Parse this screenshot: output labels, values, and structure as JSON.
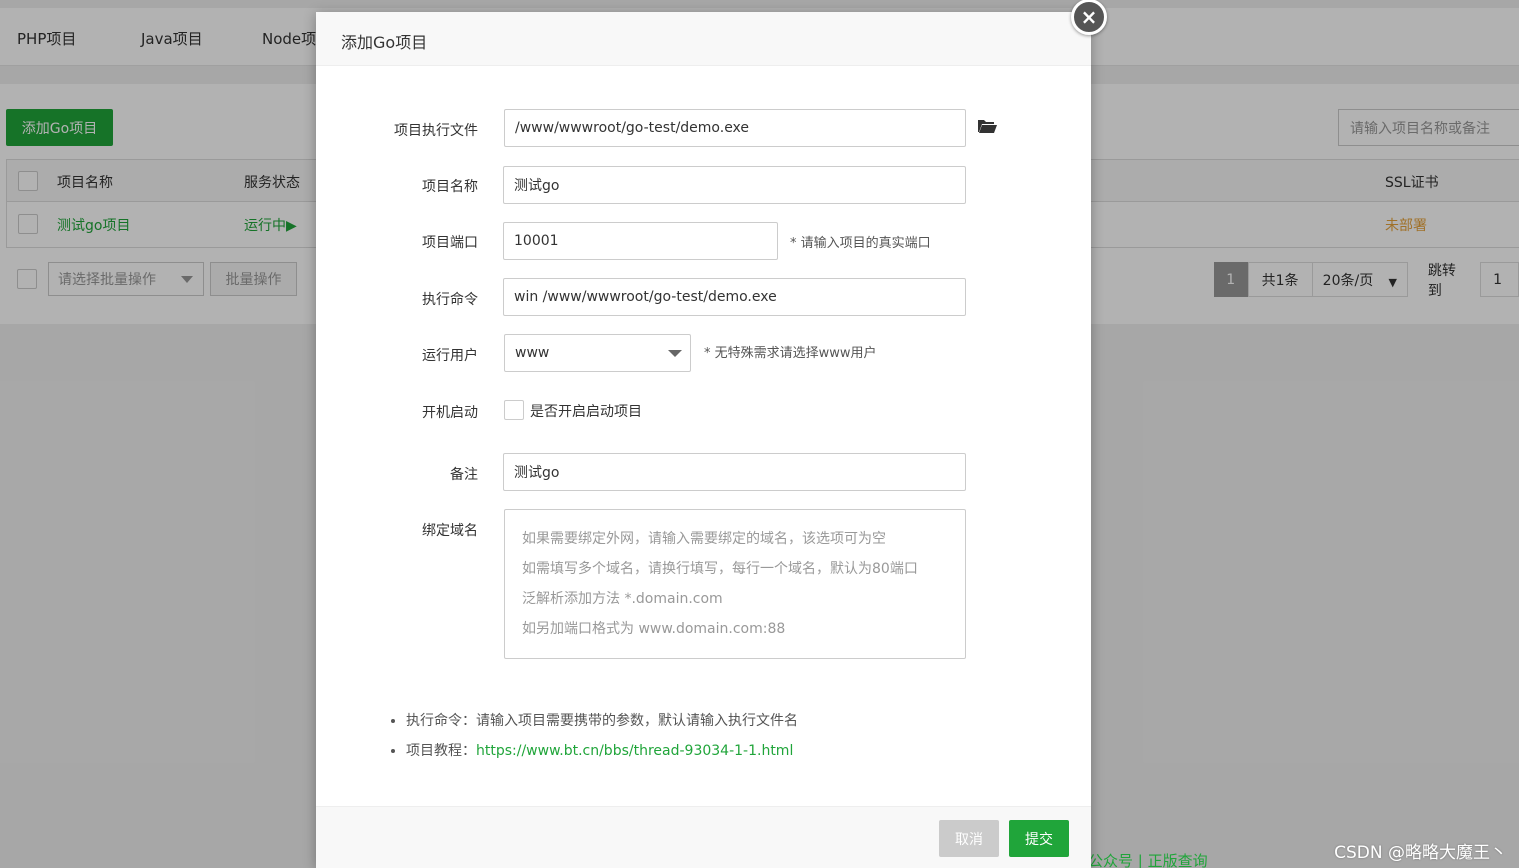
{
  "nav": {
    "tabs": [
      "PHP项目",
      "Java项目",
      "Node项目"
    ]
  },
  "page": {
    "add_button": "添加Go项目",
    "search_placeholder": "请输入项目名称或备注",
    "columns": {
      "name": "项目名称",
      "status": "服务状态",
      "ssl": "SSL证书"
    },
    "row": {
      "name": "测试go项目",
      "status": "运行中▶",
      "ssl": "未部署"
    },
    "batch_select": "请选择批量操作",
    "batch_button": "批量操作",
    "pager": {
      "current": "1",
      "total": "共1条",
      "per_page": "20条/页",
      "jump": "跳转到",
      "jump_value": "1"
    },
    "footer_links": "公众号 | 正版查询"
  },
  "modal": {
    "title": "添加Go项目",
    "close": "×",
    "fields": {
      "exec_file": {
        "label": "项目执行文件",
        "value": "/www/wwwroot/go-test/demo.exe"
      },
      "name": {
        "label": "项目名称",
        "value": "测试go"
      },
      "port": {
        "label": "项目端口",
        "value": "10001",
        "hint": "* 请输入项目的真实端口"
      },
      "command": {
        "label": "执行命令",
        "value": "win /www/wwwroot/go-test/demo.exe"
      },
      "user": {
        "label": "运行用户",
        "value": "www",
        "hint": "* 无特殊需求请选择www用户"
      },
      "autostart": {
        "label": "开机启动",
        "checkbox_label": "是否开启启动项目"
      },
      "remark": {
        "label": "备注",
        "value": "测试go"
      },
      "domain": {
        "label": "绑定域名",
        "placeholder_lines": [
          "如果需要绑定外网，请输入需要绑定的域名，该选项可为空",
          "如需填写多个域名，请换行填写，每行一个域名，默认为80端口",
          "泛解析添加方法 *.domain.com",
          "如另加端口格式为 www.domain.com:88"
        ]
      }
    },
    "tips": {
      "command_tip": "执行命令：请输入项目需要携带的参数，默认请输入执行文件名",
      "tutorial_label": "项目教程：",
      "tutorial_link": "https://www.bt.cn/bbs/thread-93034-1-1.html"
    },
    "buttons": {
      "cancel": "取消",
      "submit": "提交"
    }
  },
  "watermark": "CSDN @略略大魔王丶",
  "colors": {
    "accent": "#20a53a",
    "warning": "#e6a23c"
  }
}
